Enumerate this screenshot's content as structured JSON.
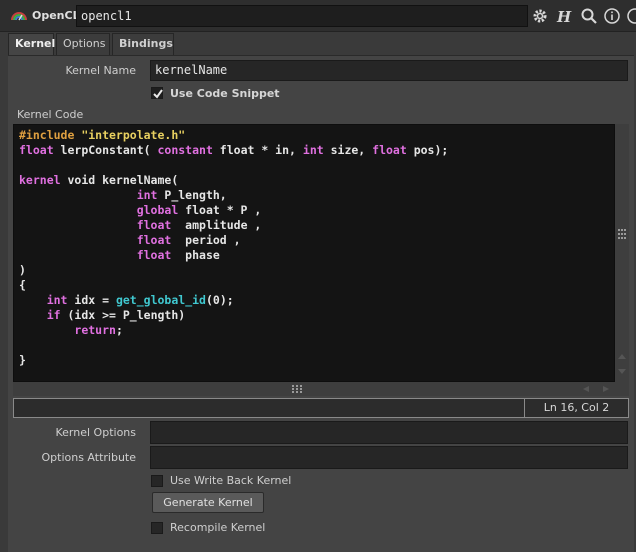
{
  "header": {
    "node_type": "OpenCL",
    "node_name": "opencl1"
  },
  "tabs": [
    {
      "label": "Kernel"
    },
    {
      "label": "Options"
    },
    {
      "label": "Bindings"
    }
  ],
  "kernel": {
    "kernel_name_label": "Kernel Name",
    "kernel_name_value": "kernelName",
    "use_code_snippet_label": "Use Code Snippet",
    "use_code_snippet_checked": true,
    "kernel_code_label": "Kernel Code",
    "code_lines": [
      [
        {
          "t": "#include ",
          "c": "pp"
        },
        {
          "t": "\"interpolate.h\"",
          "c": "str"
        }
      ],
      [
        {
          "t": "float",
          "c": "kw"
        },
        {
          "t": " lerpConstant( ",
          "c": ""
        },
        {
          "t": "constant",
          "c": "kw"
        },
        {
          "t": " float * in, ",
          "c": ""
        },
        {
          "t": "int",
          "c": "kw"
        },
        {
          "t": " size, ",
          "c": ""
        },
        {
          "t": "float",
          "c": "kw"
        },
        {
          "t": " pos);",
          "c": ""
        }
      ],
      [],
      [
        {
          "t": "kernel",
          "c": "kw"
        },
        {
          "t": " void kernelName(",
          "c": ""
        }
      ],
      [
        {
          "t": "                 ",
          "c": ""
        },
        {
          "t": "int",
          "c": "kw"
        },
        {
          "t": " P_length,",
          "c": ""
        }
      ],
      [
        {
          "t": "                 ",
          "c": ""
        },
        {
          "t": "global",
          "c": "kw"
        },
        {
          "t": " float * P ,",
          "c": ""
        }
      ],
      [
        {
          "t": "                 ",
          "c": ""
        },
        {
          "t": "float",
          "c": "kw"
        },
        {
          "t": "  amplitude ,",
          "c": ""
        }
      ],
      [
        {
          "t": "                 ",
          "c": ""
        },
        {
          "t": "float",
          "c": "kw"
        },
        {
          "t": "  period ,",
          "c": ""
        }
      ],
      [
        {
          "t": "                 ",
          "c": ""
        },
        {
          "t": "float",
          "c": "kw"
        },
        {
          "t": "  phase",
          "c": ""
        }
      ],
      [
        {
          "t": ")",
          "c": ""
        }
      ],
      [
        {
          "t": "{",
          "c": ""
        }
      ],
      [
        {
          "t": "    ",
          "c": ""
        },
        {
          "t": "int",
          "c": "kw"
        },
        {
          "t": " idx = ",
          "c": ""
        },
        {
          "t": "get_global_id",
          "c": "fn"
        },
        {
          "t": "(0);",
          "c": ""
        }
      ],
      [
        {
          "t": "    ",
          "c": ""
        },
        {
          "t": "if",
          "c": "kw"
        },
        {
          "t": " (idx >= P_length)",
          "c": ""
        }
      ],
      [
        {
          "t": "        ",
          "c": ""
        },
        {
          "t": "return",
          "c": "kw"
        },
        {
          "t": ";",
          "c": ""
        }
      ],
      [],
      [
        {
          "t": "}",
          "c": ""
        }
      ]
    ],
    "cursor_position": "Ln 16, Col 2",
    "kernel_options_label": "Kernel Options",
    "kernel_options_value": "",
    "options_attribute_label": "Options Attribute",
    "options_attribute_value": "",
    "use_write_back_kernel_label": "Use Write Back Kernel",
    "generate_kernel_label": "Generate Kernel",
    "recompile_kernel_label": "Recompile Kernel"
  },
  "colors": {
    "keyword": "#e070e0",
    "preprocessor": "#e0a040",
    "string": "#e8d060",
    "function": "#40c8d0"
  }
}
